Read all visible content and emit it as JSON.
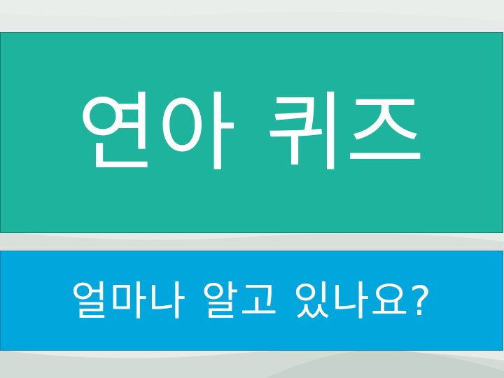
{
  "slide": {
    "title": "연아 퀴즈",
    "subtitle": "얼마나 알고 있나요?"
  },
  "colors": {
    "background": "#e6ebe8",
    "title_box": "#1db39c",
    "subtitle_box": "#00a6dc",
    "text": "#ffffff"
  }
}
